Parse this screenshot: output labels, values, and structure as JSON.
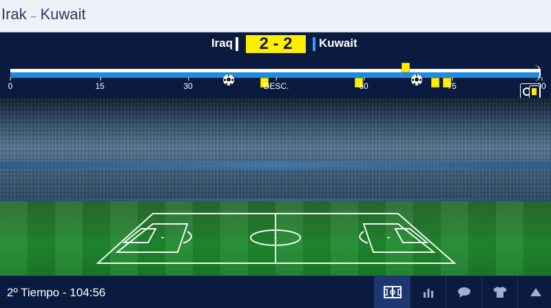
{
  "header": {
    "home_name": "Irak",
    "separator": "–",
    "away_name": "Kuwait"
  },
  "scoreboard": {
    "home_team": "Iraq",
    "away_team": "Kuwait",
    "score": "2 - 2",
    "home_color": "#ffffff",
    "away_color": "#29a3ff",
    "accent_color": "#ffee00"
  },
  "timeline": {
    "ticks": [
      "0",
      "15",
      "30",
      "DESC.",
      "60",
      "75",
      "90"
    ],
    "events": [
      {
        "type": "goal",
        "team": "home",
        "minute": 37
      },
      {
        "type": "yellow-card",
        "team": "away",
        "minute": 43
      },
      {
        "type": "yellow-card",
        "team": "away",
        "minute": 59
      },
      {
        "type": "yellow-card",
        "team": "home",
        "minute": 67
      },
      {
        "type": "goal",
        "team": "away",
        "minute": 69
      },
      {
        "type": "yellow-card",
        "team": "away",
        "minute": 72
      },
      {
        "type": "yellow-card",
        "team": "away",
        "minute": 74
      }
    ],
    "compare_icon": "binoculars-icon",
    "filter_icon": "yellow-card-icon"
  },
  "status": {
    "period_time": "2º Tiempo - 104:56"
  },
  "nav": [
    {
      "icon": "pitch-icon",
      "active": true
    },
    {
      "icon": "stats-icon",
      "active": false
    },
    {
      "icon": "comments-icon",
      "active": false
    },
    {
      "icon": "lineup-shirt-icon",
      "active": false
    },
    {
      "icon": "arrow-up-icon",
      "active": false
    }
  ]
}
